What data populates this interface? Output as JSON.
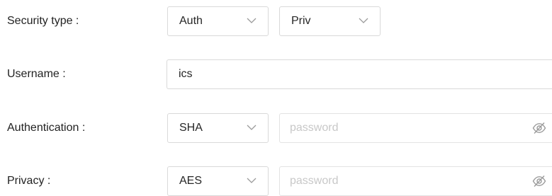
{
  "form": {
    "security_type": {
      "label": "Security type :",
      "auth_select": {
        "value": "Auth"
      },
      "priv_select": {
        "value": "Priv"
      }
    },
    "username": {
      "label": "Username :",
      "value": "ics"
    },
    "authentication": {
      "label": "Authentication :",
      "protocol_select": {
        "value": "SHA"
      },
      "password": {
        "placeholder": "password",
        "value": ""
      }
    },
    "privacy": {
      "label": "Privacy :",
      "protocol_select": {
        "value": "AES"
      },
      "password": {
        "placeholder": "password",
        "value": ""
      }
    }
  },
  "icons": {
    "dropdown": "chevron-down-icon",
    "visibility_toggle": "eye-off-icon"
  },
  "colors": {
    "border": "#d9d9d9",
    "text": "#222222",
    "placeholder": "#c4c4c4",
    "icon": "#9a9a9a"
  }
}
